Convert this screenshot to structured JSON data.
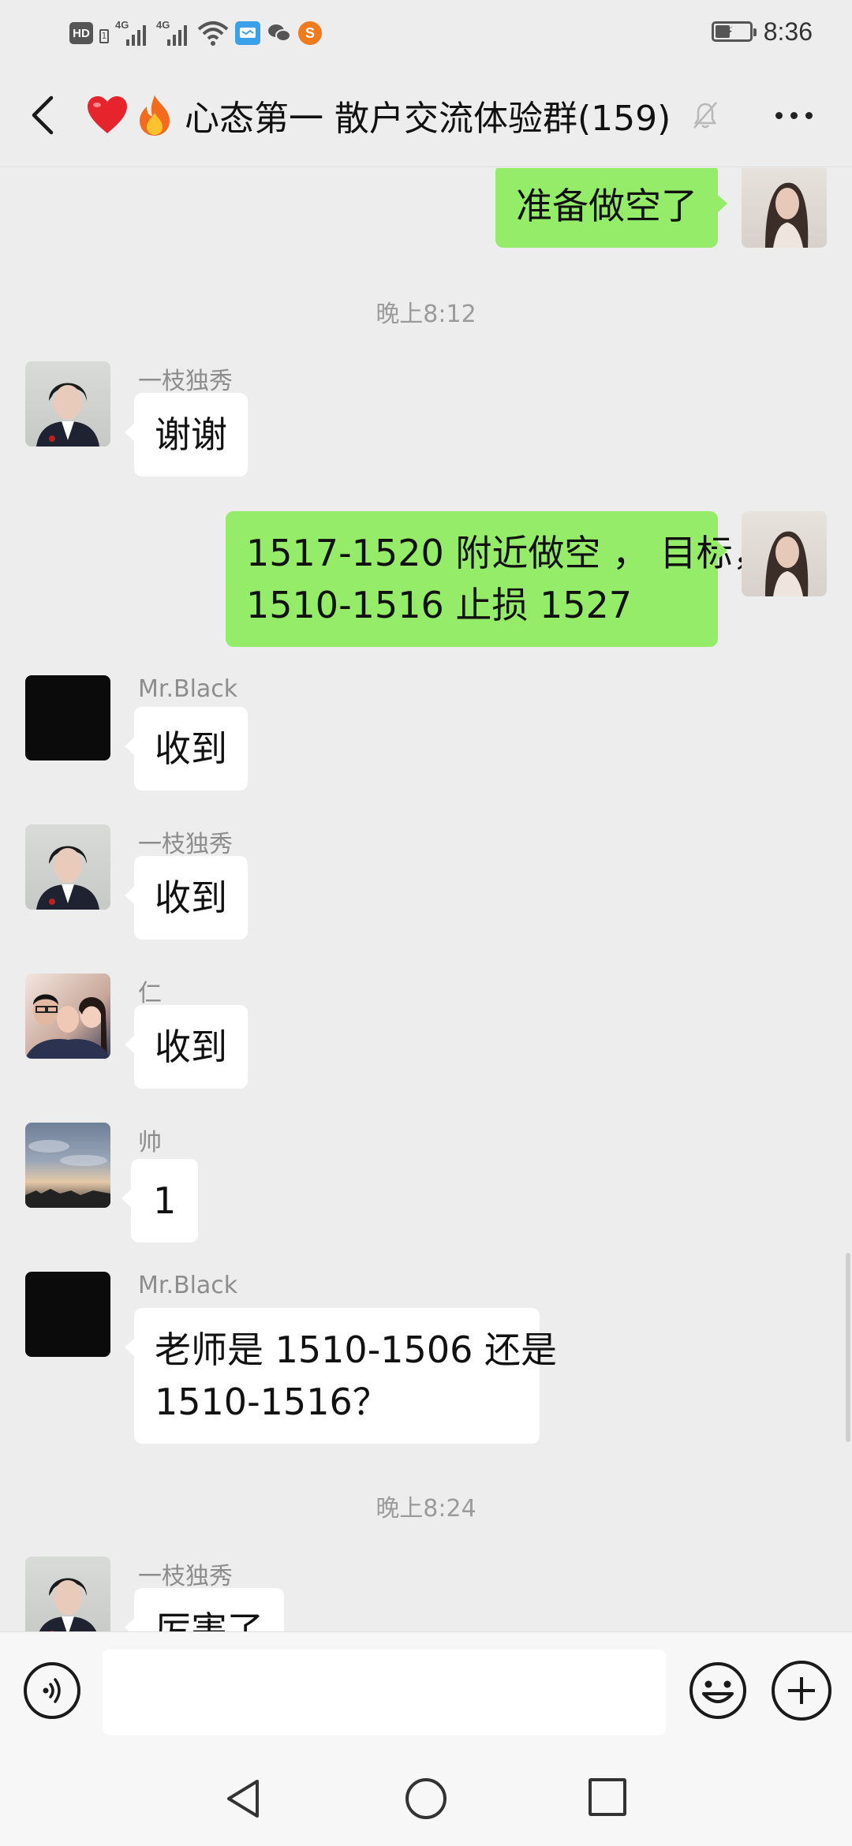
{
  "status_bar": {
    "left_indicators": {
      "hd": "HD",
      "sim_slot": "1",
      "network_1": "4G",
      "network_2": "4G"
    },
    "icons": [
      "hd-icon",
      "signal-icon",
      "signal-icon",
      "wifi-icon",
      "message-app-icon",
      "wechat-icon",
      "sogou-icon"
    ],
    "battery_icon": "battery-charging-icon",
    "time": "8:36"
  },
  "header": {
    "back_icon": "chevron-left-icon",
    "emoji_1": "❤️",
    "emoji_2": "🔥",
    "title": "心态第一 散户交流体验群(159)",
    "mute_icon": "bell-muted-icon",
    "more_icon": "more-horizontal-icon"
  },
  "messages": [
    {
      "type": "out",
      "text": "准备做空了"
    },
    {
      "type": "time",
      "text": "晚上8:12"
    },
    {
      "type": "in",
      "sender": "一枝独秀",
      "text": "谢谢"
    },
    {
      "type": "out",
      "lines": [
        "1517-1520 附近做空 ， 目标，",
        "1510-1516 止损 1527"
      ]
    },
    {
      "type": "in",
      "sender": "Mr.Black",
      "text": "收到"
    },
    {
      "type": "in",
      "sender": "一枝独秀",
      "text": "收到"
    },
    {
      "type": "in",
      "sender": "仁",
      "text": "收到"
    },
    {
      "type": "in",
      "sender": "帅",
      "text": "1"
    },
    {
      "type": "in",
      "sender": "Mr.Black",
      "lines": [
        "老师是 1510-1506 还是",
        "1510-1516？"
      ]
    },
    {
      "type": "time",
      "text": "晚上8:24"
    },
    {
      "type": "in",
      "sender": "一枝独秀",
      "text": "厉害了"
    }
  ],
  "input_bar": {
    "voice_icon": "voice-icon",
    "placeholder": "",
    "emoji_icon": "smiley-icon",
    "plus_icon": "plus-circle-icon"
  },
  "nav_bar": {
    "back_icon": "triangle-back-icon",
    "home_icon": "circle-home-icon",
    "recent_icon": "square-recent-icon"
  },
  "colors": {
    "background": "#ededed",
    "outgoing_bubble": "#95ec69",
    "incoming_bubble": "#ffffff",
    "timestamp": "#9b9b9b",
    "sender_name": "#8d8d8d"
  }
}
